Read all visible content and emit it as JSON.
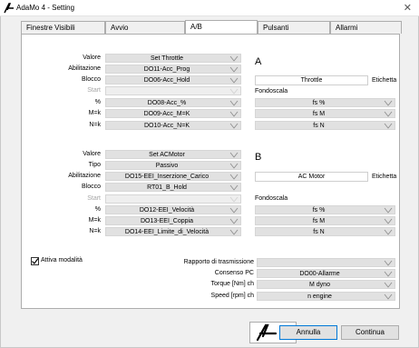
{
  "window": {
    "title": "AdaMo 4 - Setting",
    "close_glyph": "✕"
  },
  "tabs": [
    {
      "label": "Finestre Visibili"
    },
    {
      "label": "Avvio"
    },
    {
      "label": "A/B"
    },
    {
      "label": "Pulsanti"
    },
    {
      "label": "Allarmi"
    }
  ],
  "active_tab": "A/B",
  "section_a": {
    "letter": "A",
    "rows": [
      {
        "label": "Valore",
        "value": "Set Throttle"
      },
      {
        "label": "Abilitazione",
        "value": "DO11-Acc_Prog"
      },
      {
        "label": "Blocco",
        "value": "DO06-Acc_Hold"
      },
      {
        "label": "Start",
        "value": ""
      },
      {
        "label": "%",
        "value": "DO08-Acc_%"
      },
      {
        "label": "M=k",
        "value": "DO09-Acc_M=K"
      },
      {
        "label": "N=k",
        "value": "DO10-Acc_N=K"
      }
    ],
    "etichetta_value": "Throttle",
    "etichetta_label": "Etichetta",
    "fondoscala_label": "Fondoscala",
    "fondoscala": [
      "fs %",
      "fs M",
      "fs N"
    ]
  },
  "section_b": {
    "letter": "B",
    "rows": [
      {
        "label": "Valore",
        "value": "Set ACMotor"
      },
      {
        "label": "Tipo",
        "value": "Passivo"
      },
      {
        "label": "Abilitazione",
        "value": "DO15-EEI_Inserzione_Carico"
      },
      {
        "label": "Blocco",
        "value": "RT01_B_Hold"
      },
      {
        "label": "Start",
        "value": ""
      },
      {
        "label": "%",
        "value": "DO12-EEI_Velocità"
      },
      {
        "label": "M=k",
        "value": "DO13-EEI_Coppia"
      },
      {
        "label": "N=k",
        "value": "DO14-EEI_Limite_di_Velocità"
      }
    ],
    "etichetta_value": "AC Motor",
    "etichetta_label": "Etichetta",
    "fondoscala_label": "Fondoscala",
    "fondoscala": [
      "fs %",
      "fs M",
      "fs N"
    ]
  },
  "options": {
    "attiva_label": "Attiva modalità",
    "attiva_checked": true,
    "rows": [
      {
        "label": "Rapporto di trasmissione",
        "value": ""
      },
      {
        "label": "Consenso PC",
        "value": "DO00-Allarme"
      },
      {
        "label": "Torque [Nm] ch",
        "value": "M dyno"
      },
      {
        "label": "Speed [rpm] ch",
        "value": "n engine"
      }
    ]
  },
  "buttons": {
    "cancel": "Annulla",
    "continue": "Continua"
  },
  "colors": {
    "accent": "#0078d7",
    "combo_bg": "#e1e1e1"
  }
}
